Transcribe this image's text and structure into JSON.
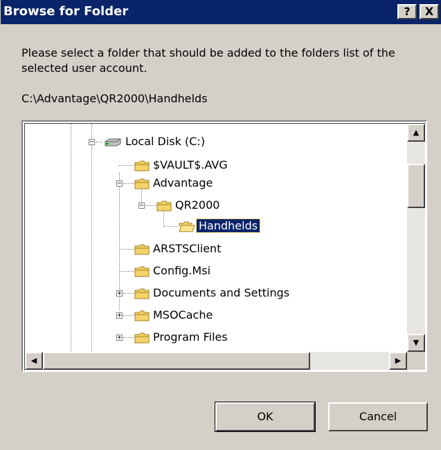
{
  "window": {
    "title": "Browse for Folder",
    "help_label": "?",
    "close_label": "X"
  },
  "prompt": "Please select a folder that should be added to the folders list of the selected user account.",
  "current_path": "C:\\Advantage\\QR2000\\Handhelds",
  "tree": {
    "items": [
      {
        "label": "Local Disk (C:)",
        "icon": "drive-icon",
        "expanded": true
      },
      {
        "label": "$VAULT$.AVG",
        "icon": "folder-icon"
      },
      {
        "label": "Advantage",
        "icon": "folder-icon",
        "expanded": true
      },
      {
        "label": "QR2000",
        "icon": "folder-icon",
        "expanded": true
      },
      {
        "label": "Handhelds",
        "icon": "folder-open-icon",
        "selected": true
      },
      {
        "label": "ARSTSClient",
        "icon": "folder-icon"
      },
      {
        "label": "Config.Msi",
        "icon": "folder-icon"
      },
      {
        "label": "Documents and Settings",
        "icon": "folder-icon",
        "expanded": false
      },
      {
        "label": "MSOCache",
        "icon": "folder-icon",
        "expanded": false
      },
      {
        "label": "Program Files",
        "icon": "folder-icon",
        "expanded": false
      }
    ]
  },
  "buttons": {
    "ok": "OK",
    "cancel": "Cancel"
  },
  "colors": {
    "titlebar": "#0a246a",
    "face": "#d4d0c8",
    "selection": "#0a246a",
    "folder": "#f5d36a"
  }
}
